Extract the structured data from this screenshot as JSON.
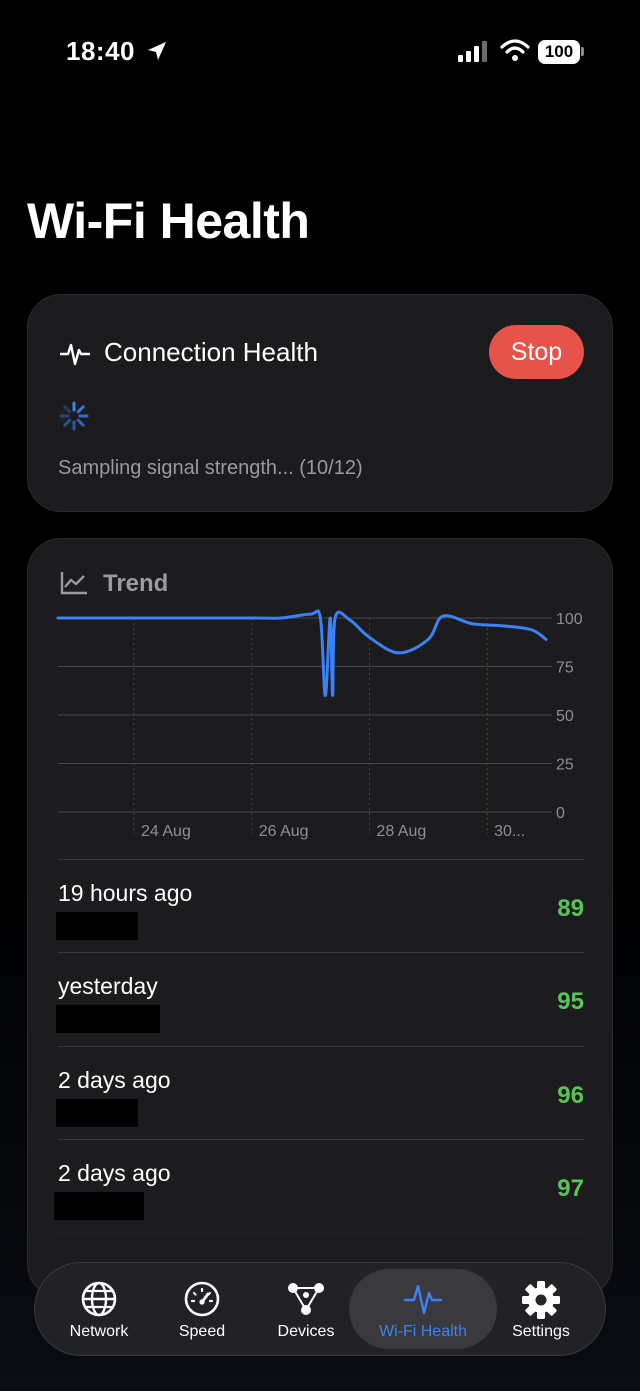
{
  "status_bar": {
    "time": "18:40",
    "battery": "100"
  },
  "page": {
    "title": "Wi-Fi Health"
  },
  "health_card": {
    "title": "Connection Health",
    "stop_label": "Stop",
    "status": "Sampling signal strength... (10/12)"
  },
  "trend_card": {
    "title": "Trend"
  },
  "chart_data": {
    "type": "line",
    "title": "",
    "xlabel": "",
    "ylabel": "",
    "ylim": [
      0,
      100
    ],
    "y_ticks": [
      "100",
      "75",
      "50",
      "25",
      "0"
    ],
    "x_tick_labels": [
      "24 Aug",
      "26 Aug",
      "28 Aug",
      "30..."
    ],
    "grid": true,
    "series": [
      {
        "color": "#3b82f6",
        "points": [
          [
            "22 Aug 17:00",
            100
          ],
          [
            "23 Aug 12:00",
            100
          ],
          [
            "24 Aug 00:00",
            100
          ],
          [
            "25 Aug 00:00",
            100
          ],
          [
            "26 Aug 00:00",
            100
          ],
          [
            "26 Aug 12:00",
            100
          ],
          [
            "27 Aug 00:00",
            102
          ],
          [
            "27 Aug 04:00",
            100
          ],
          [
            "27 Aug 06:00",
            60
          ],
          [
            "27 Aug 08:00",
            100
          ],
          [
            "27 Aug 09:00",
            60
          ],
          [
            "27 Aug 10:00",
            100
          ],
          [
            "27 Aug 16:00",
            99
          ],
          [
            "28 Aug 00:00",
            90
          ],
          [
            "28 Aug 12:00",
            82
          ],
          [
            "29 Aug 00:00",
            89
          ],
          [
            "29 Aug 06:00",
            101
          ],
          [
            "29 Aug 18:00",
            97
          ],
          [
            "30 Aug 06:00",
            96
          ],
          [
            "30 Aug 18:00",
            94
          ],
          [
            "31 Aug 00:00",
            89
          ]
        ]
      }
    ]
  },
  "history": [
    {
      "label": "19 hours ago",
      "score": "89"
    },
    {
      "label": "yesterday",
      "score": "95"
    },
    {
      "label": "2 days ago",
      "score": "96"
    },
    {
      "label": "2 days ago",
      "score": "97"
    },
    {
      "label": "",
      "score": ""
    }
  ],
  "tab_bar": {
    "tabs": [
      {
        "label": "Network",
        "icon": "globe-icon"
      },
      {
        "label": "Speed",
        "icon": "gauge-icon"
      },
      {
        "label": "Devices",
        "icon": "devices-icon"
      },
      {
        "label": "Wi-Fi Health",
        "icon": "pulse-icon",
        "active": true
      },
      {
        "label": "Settings",
        "icon": "gear-icon"
      }
    ]
  },
  "colors": {
    "accent": "#3b82f6",
    "stop": "#e5534b",
    "score_good": "#58c457",
    "card_bg": "#1c1c1e"
  }
}
